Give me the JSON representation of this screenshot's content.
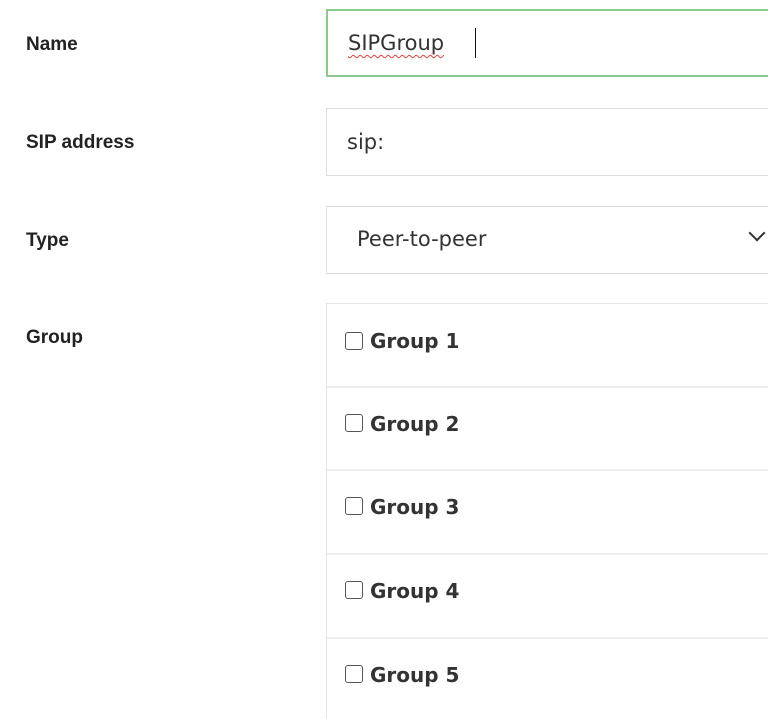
{
  "form": {
    "name": {
      "label": "Name",
      "value": "SIPGroup"
    },
    "sip_address": {
      "label": "SIP address",
      "value": "sip:"
    },
    "type": {
      "label": "Type",
      "selected": "Peer-to-peer"
    },
    "group": {
      "label": "Group",
      "options": [
        {
          "label": "Group 1",
          "checked": false
        },
        {
          "label": "Group 2",
          "checked": false
        },
        {
          "label": "Group 3",
          "checked": false
        },
        {
          "label": "Group 4",
          "checked": false
        },
        {
          "label": "Group 5",
          "checked": false
        }
      ]
    }
  },
  "colors": {
    "focus_border": "#8cc98c",
    "spellcheck_underline": "#e04040"
  },
  "icons": {
    "type_dropdown": "chevron-down-icon"
  }
}
